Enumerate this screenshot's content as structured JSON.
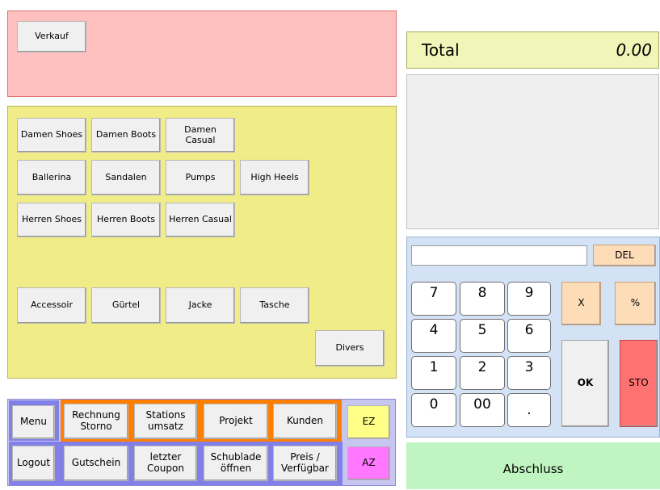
{
  "top": {
    "verkauf_label": "Verkauf"
  },
  "categories": {
    "row1": [
      "Damen Shoes",
      "Damen Boots",
      "Damen Casual"
    ],
    "row2": [
      "Ballerina",
      "Sandalen",
      "Pumps",
      "High Heels"
    ],
    "row3": [
      "Herren Shoes",
      "Herren Boots",
      "Herren Casual"
    ],
    "row4": [
      "Accessoir",
      "Gürtel",
      "Jacke",
      "Tasche"
    ],
    "divers": "Divers"
  },
  "bottom": {
    "menu": "Menu",
    "rechnung_storno": "Rechnung\nStorno",
    "stations_umsatz": "Stations\numsatz",
    "projekt": "Projekt",
    "kunden": "Kunden",
    "ez": "EZ",
    "logout": "Logout",
    "gutschein": "Gutschein",
    "letzter_coupon": "letzter\nCoupon",
    "schublade_oeffnen": "Schublade\nöffnen",
    "preis_verfuegbar": "Preis /\nVerfügbar",
    "az": "AZ"
  },
  "total": {
    "label": "Total",
    "value": "0.00"
  },
  "numpad": {
    "input_value": "",
    "del": "DEL",
    "keys": [
      "7",
      "8",
      "9",
      "4",
      "5",
      "6",
      "1",
      "2",
      "3",
      "0",
      "00",
      "."
    ],
    "multiply": "X",
    "percent": "%",
    "ok": "OK",
    "sto": "STO"
  },
  "abschluss": "Abschluss",
  "colors": {
    "top_panel": "#ffc0c0",
    "category_panel": "#f0ec88",
    "accent_orange": "#ff7f00",
    "accent_blue": "#8080e8",
    "total_bg": "#f2f5b8",
    "sto_red": "#ff7272",
    "abschluss_green": "#c0f4c0"
  }
}
